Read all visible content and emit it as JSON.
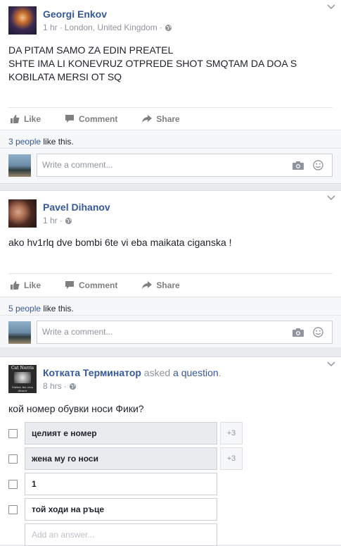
{
  "posts": [
    {
      "author": "Georgi Enkov",
      "time": "1 hr",
      "location": "London, United Kingdom",
      "text_lines": [
        "DA PITAM SAMO ZA EDIN PREATEL",
        "SHTE IMA LI KONEVRUZ OTPREDE SHOT SMQTAM DA DOA S",
        "KOBILATA MERSI OT SQ"
      ],
      "like_label": "Like",
      "comment_label": "Comment",
      "share_label": "Share",
      "likes_count": "3 people",
      "likes_suffix": " like this.",
      "comment_placeholder": "Write a comment..."
    },
    {
      "author": "Pavel Dihanov",
      "time": "1 hr",
      "text": "ako hv1rlq dve bombi 6te vi eba maikata ciganska !",
      "like_label": "Like",
      "comment_label": "Comment",
      "share_label": "Share",
      "likes_count": "5 people",
      "likes_suffix": " like this.",
      "comment_placeholder": "Write a comment..."
    },
    {
      "author": "Котката Терминатор",
      "action": " asked ",
      "action_link": "a question",
      "action_end": ".",
      "time": "8 hrs",
      "question": "кой номер обувки носи Фики?",
      "avatar_text": [
        "Cat Norris",
        "Makes his own dinner"
      ],
      "options": [
        {
          "label": "целият е номер",
          "count": "+3"
        },
        {
          "label": "жена му го носи",
          "count": "+3"
        },
        {
          "label": "1"
        },
        {
          "label": "той ходи на ръце"
        }
      ],
      "add_answer_placeholder": "Add an answer..."
    }
  ]
}
